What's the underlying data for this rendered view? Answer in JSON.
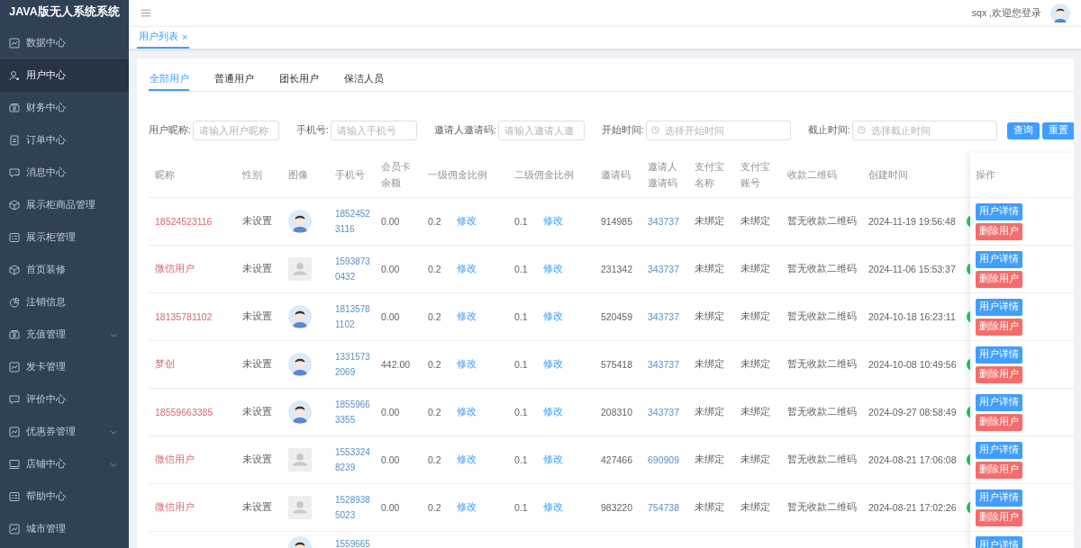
{
  "app_title": "JAVA版无人系统系统",
  "sidebar": {
    "items": [
      {
        "label": "数据中心",
        "selected": false,
        "has_submenu": false
      },
      {
        "label": "用户中心",
        "selected": true,
        "has_submenu": false
      },
      {
        "label": "财务中心",
        "selected": false,
        "has_submenu": false
      },
      {
        "label": "订单中心",
        "selected": false,
        "has_submenu": false
      },
      {
        "label": "消息中心",
        "selected": false,
        "has_submenu": false
      },
      {
        "label": "展示柜商品管理",
        "selected": false,
        "has_submenu": false
      },
      {
        "label": "展示柜管理",
        "selected": false,
        "has_submenu": false
      },
      {
        "label": "首页装修",
        "selected": false,
        "has_submenu": false
      },
      {
        "label": "注销信息",
        "selected": false,
        "has_submenu": false
      },
      {
        "label": "充值管理",
        "selected": false,
        "has_submenu": true
      },
      {
        "label": "发卡管理",
        "selected": false,
        "has_submenu": false
      },
      {
        "label": "评价中心",
        "selected": false,
        "has_submenu": false
      },
      {
        "label": "优惠券管理",
        "selected": false,
        "has_submenu": true
      },
      {
        "label": "店铺中心",
        "selected": false,
        "has_submenu": true
      },
      {
        "label": "帮助中心",
        "selected": false,
        "has_submenu": false
      },
      {
        "label": "城市管理",
        "selected": false,
        "has_submenu": false
      }
    ]
  },
  "header": {
    "welcome": "sqx ,欢迎您登录"
  },
  "page_tabs": [
    {
      "label": "用户列表",
      "selected": true,
      "close": "×"
    }
  ],
  "user_tabs": [
    {
      "label": "全部用户",
      "selected": true
    },
    {
      "label": "普通用户",
      "selected": false
    },
    {
      "label": "团长用户",
      "selected": false
    },
    {
      "label": "保洁人员",
      "selected": false
    }
  ],
  "filters": [
    {
      "kind": "text",
      "label": "用户昵称:",
      "placeholder": "请输入用户昵称"
    },
    {
      "kind": "text",
      "label": "手机号:",
      "placeholder": "请输入手机号"
    },
    {
      "kind": "text",
      "label": "邀请人邀请码:",
      "placeholder": "请输入邀请人邀"
    },
    {
      "kind": "date",
      "label": "开始时间:",
      "placeholder": "选择开始时间"
    },
    {
      "kind": "date",
      "label": "截止时间:",
      "placeholder": "选择截止时间"
    }
  ],
  "filter_buttons": [
    "查询",
    "重置"
  ],
  "table": {
    "columns": [
      "昵称",
      "性别",
      "图像",
      "手机号",
      "会员卡余额",
      "一级佣金比例",
      "二级佣金比例",
      "邀请码",
      "邀请人邀请码",
      "支付宝名称",
      "支付宝账号",
      "收款二维码",
      "创建时间"
    ],
    "actions_header": "操作",
    "rows": [
      {
        "nickname": "18524523116",
        "gender": "未设置",
        "avatar": {
          "kind": "cartoon"
        },
        "phone": "18524523116",
        "balance": "0.00",
        "level1": "0.2",
        "level1_action": "修改",
        "level2": "0.1",
        "level2_action": "修改",
        "invite_code": "914985",
        "inviter_code": "343737",
        "alipay_name": "未绑定",
        "alipay_account": "未绑定",
        "qr_code": "暂无收款二维码",
        "created": "2024-11-19 19:56:48",
        "status_on": true,
        "actions": [
          "用户详情",
          "删除用户"
        ]
      },
      {
        "nickname": "微信用户",
        "gender": "未设置",
        "avatar": {
          "kind": "placeholder"
        },
        "phone": "15938730432",
        "balance": "0.00",
        "level1": "0.2",
        "level1_action": "修改",
        "level2": "0.1",
        "level2_action": "修改",
        "invite_code": "231342",
        "inviter_code": "343737",
        "alipay_name": "未绑定",
        "alipay_account": "未绑定",
        "qr_code": "暂无收款二维码",
        "created": "2024-11-06 15:53:37",
        "status_on": true,
        "actions": [
          "用户详情",
          "删除用户"
        ]
      },
      {
        "nickname": "18135781102",
        "gender": "未设置",
        "avatar": {
          "kind": "cartoon"
        },
        "phone": "18135781102",
        "balance": "0.00",
        "level1": "0.2",
        "level1_action": "修改",
        "level2": "0.1",
        "level2_action": "修改",
        "invite_code": "520459",
        "inviter_code": "343737",
        "alipay_name": "未绑定",
        "alipay_account": "未绑定",
        "qr_code": "暂无收款二维码",
        "created": "2024-10-18 16:23:11",
        "status_on": true,
        "actions": [
          "用户详情",
          "删除用户"
        ]
      },
      {
        "nickname": "梦创",
        "gender": "未设置",
        "avatar": {
          "kind": "cartoon"
        },
        "phone": "13315732069",
        "balance": "442.00",
        "level1": "0.2",
        "level1_action": "修改",
        "level2": "0.1",
        "level2_action": "修改",
        "invite_code": "575418",
        "inviter_code": "343737",
        "alipay_name": "未绑定",
        "alipay_account": "未绑定",
        "qr_code": "暂无收款二维码",
        "created": "2024-10-08 10:49:56",
        "status_on": true,
        "actions": [
          "用户详情",
          "删除用户"
        ]
      },
      {
        "nickname": "18559663385",
        "gender": "未设置",
        "avatar": {
          "kind": "cartoon"
        },
        "phone": "18559663355",
        "balance": "0.00",
        "level1": "0.2",
        "level1_action": "修改",
        "level2": "0.1",
        "level2_action": "修改",
        "invite_code": "208310",
        "inviter_code": "343737",
        "alipay_name": "未绑定",
        "alipay_account": "未绑定",
        "qr_code": "暂无收款二维码",
        "created": "2024-09-27 08:58:49",
        "status_on": true,
        "actions": [
          "用户详情",
          "删除用户"
        ]
      },
      {
        "nickname": "微信用户",
        "gender": "未设置",
        "avatar": {
          "kind": "placeholder"
        },
        "phone": "15533248239",
        "balance": "0.00",
        "level1": "0.2",
        "level1_action": "修改",
        "level2": "0.1",
        "level2_action": "修改",
        "invite_code": "427466",
        "inviter_code": "690909",
        "alipay_name": "未绑定",
        "alipay_account": "未绑定",
        "qr_code": "暂无收款二维码",
        "created": "2024-08-21 17:06:08",
        "status_on": true,
        "actions": [
          "用户详情",
          "删除用户"
        ]
      },
      {
        "nickname": "微信用户",
        "gender": "未设置",
        "avatar": {
          "kind": "placeholder"
        },
        "phone": "15289385023",
        "balance": "0.00",
        "level1": "0.2",
        "level1_action": "修改",
        "level2": "0.1",
        "level2_action": "修改",
        "invite_code": "983220",
        "inviter_code": "754738",
        "alipay_name": "未绑定",
        "alipay_account": "未绑定",
        "qr_code": "暂无收款二维码",
        "created": "2024-08-21 17:02:26",
        "status_on": true,
        "actions": [
          "用户详情",
          "删除用户"
        ]
      },
      {
        "avatar": {
          "kind": "cartoon"
        },
        "phone": "1559665",
        "actions": [
          "用户详情"
        ]
      }
    ]
  }
}
